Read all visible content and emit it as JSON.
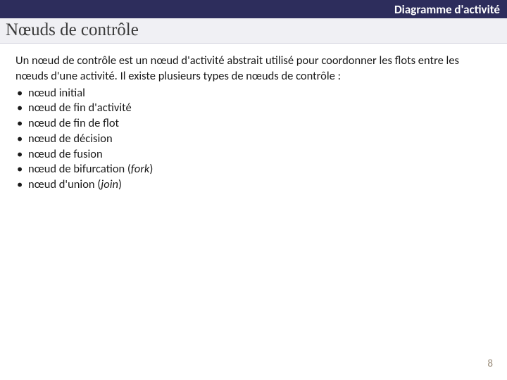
{
  "header": {
    "title": "Diagramme d'activité"
  },
  "section": {
    "title": "Nœuds de contrôle"
  },
  "content": {
    "intro": "Un nœud de contrôle est un nœud d'activité abstrait utilisé pour coordonner les flots entre les nœuds d'une activité. Il existe plusieurs types de nœuds de contrôle :",
    "bullets": [
      {
        "text": "nœud initial"
      },
      {
        "text": "nœud de fin d'activité"
      },
      {
        "text": "nœud de fin de flot"
      },
      {
        "text": "nœud de décision"
      },
      {
        "text": "nœud de fusion"
      },
      {
        "text": "nœud de bifurcation (",
        "italic": "fork",
        "after": ")"
      },
      {
        "text": "nœud d'union (",
        "italic": "join",
        "after": ")"
      }
    ]
  },
  "page_number": "8"
}
